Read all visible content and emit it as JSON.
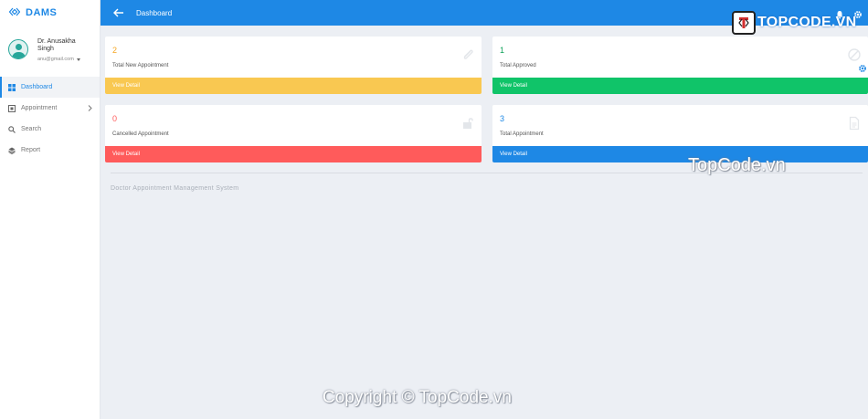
{
  "brand": {
    "name": "DAMS"
  },
  "user": {
    "name": "Dr. Anusakha Singh",
    "email": "anu@gmail.com"
  },
  "nav": [
    {
      "label": "Dashboard",
      "icon": "dashboard-icon"
    },
    {
      "label": "Appointment",
      "icon": "appointment-icon"
    },
    {
      "label": "Search",
      "icon": "search-icon"
    },
    {
      "label": "Report",
      "icon": "layers-icon"
    }
  ],
  "topbar": {
    "title": "Dashboard"
  },
  "cards": [
    {
      "value": "2",
      "label": "Total New Appointment",
      "action": "View Detail",
      "color": "#f9c851",
      "value_color": "#f5a623",
      "icon": "paperclip-icon"
    },
    {
      "value": "1",
      "label": "Total Approved",
      "action": "View Detail",
      "color": "#10c469",
      "value_color": "#10a35a",
      "icon": "ban-icon"
    },
    {
      "value": "0",
      "label": "Cancelled Appointment",
      "action": "View Detail",
      "color": "#ff5b5b",
      "value_color": "#ff5b5b",
      "icon": "unlock-icon"
    },
    {
      "value": "3",
      "label": "Total Appointment",
      "action": "View Detail",
      "color": "#1e88e5",
      "value_color": "#1e88e5",
      "icon": "file-icon"
    }
  ],
  "footer": {
    "text": "Doctor Appointment Management System"
  },
  "watermark": {
    "logo": "TOPCODE.VN",
    "center": "TopCode.vn",
    "copyright": "Copyright © TopCode.vn"
  },
  "colors": {
    "primary": "#1e88e5",
    "background": "#eceff4"
  }
}
